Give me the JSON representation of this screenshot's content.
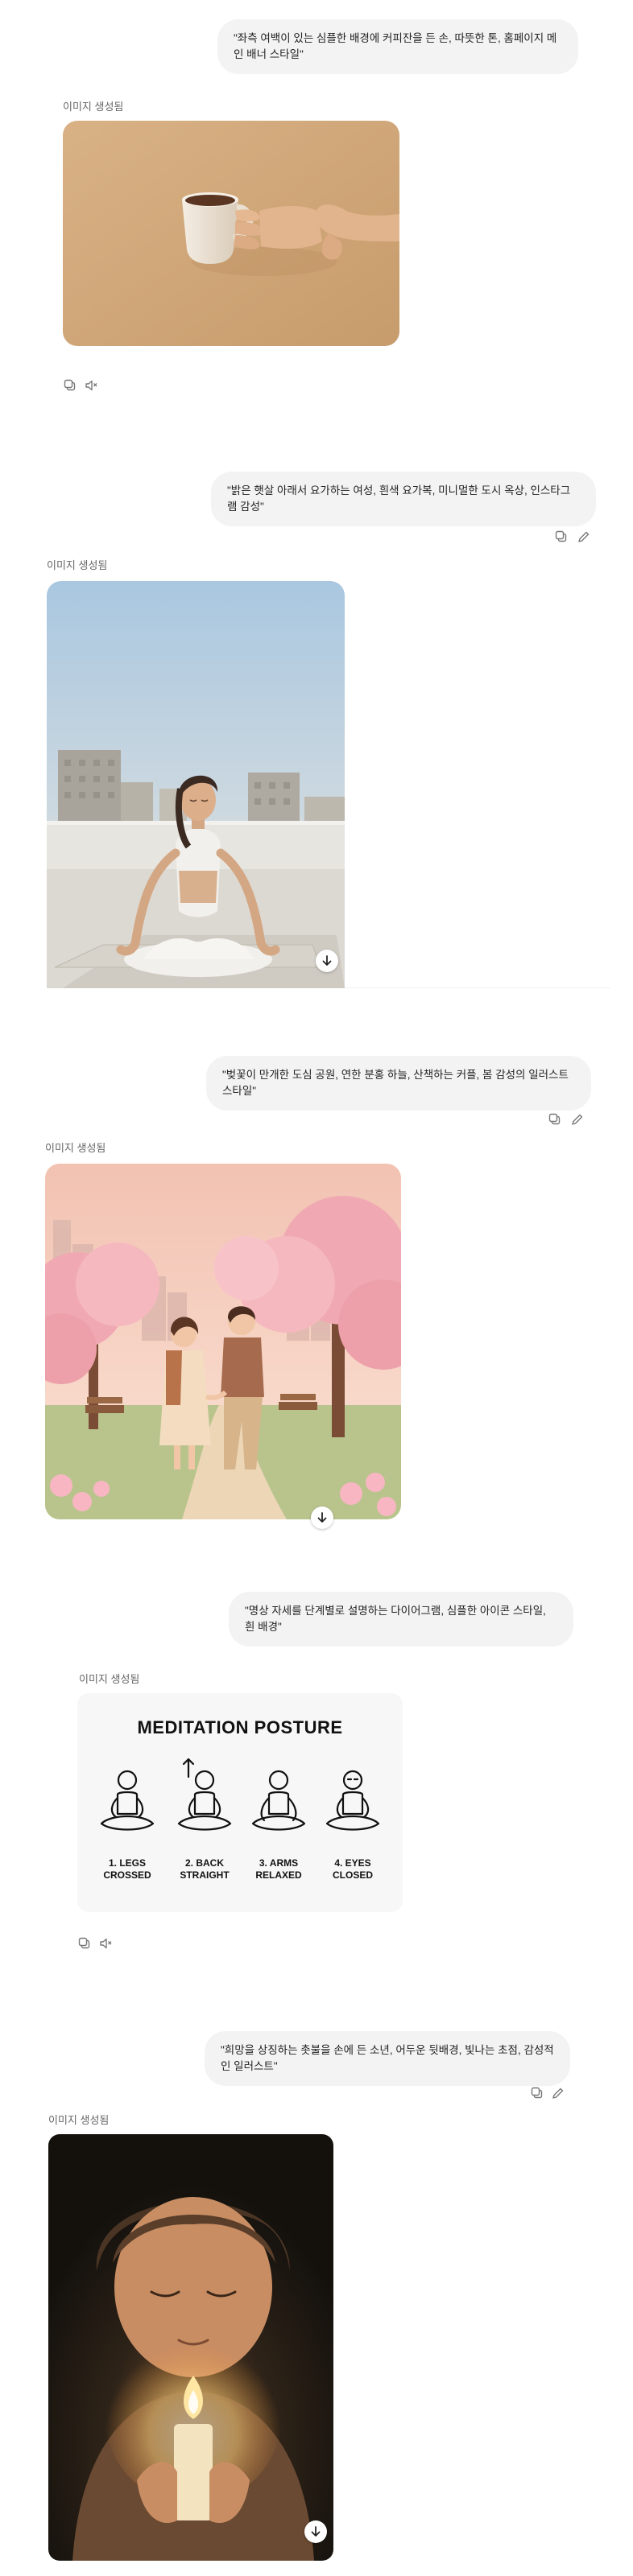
{
  "conversation": {
    "generated_label": "이미지 생성됨",
    "prompts": [
      "\"좌측 여백이 있는 심플한 배경에 커피잔을 든 손, 따뜻한 톤, 홈페이지 메인 배너 스타일\"",
      "\"밝은 햇살 아래서 요가하는 여성, 흰색 요가복, 미니멀한 도시 옥상, 인스타그램 감성\"",
      "\"벚꽃이 만개한 도심 공원, 연한 분홍 하늘, 산책하는 커플, 봄 감성의 일러스트 스타일\"",
      "\"명상 자세를 단계별로 설명하는 다이어그램, 심플한 아이콘 스타일, 흰 배경\"",
      "\"희망을 상징하는 촛불을 손에 든 소년, 어두운 뒷배경, 빛나는 초점, 감성적인 일러스트\""
    ]
  },
  "diagram": {
    "title": "MEDITATION POSTURE",
    "steps": [
      {
        "line1": "1. LEGS",
        "line2": "CROSSED"
      },
      {
        "line1": "2. BACK",
        "line2": "STRAIGHT"
      },
      {
        "line1": "3. ARMS",
        "line2": "RELAXED"
      },
      {
        "line1": "4. EYES",
        "line2": "CLOSED"
      }
    ]
  },
  "icons": {
    "copy": "copy-icon",
    "speaker": "speaker-icon",
    "edit": "edit-icon",
    "download": "download-icon"
  }
}
